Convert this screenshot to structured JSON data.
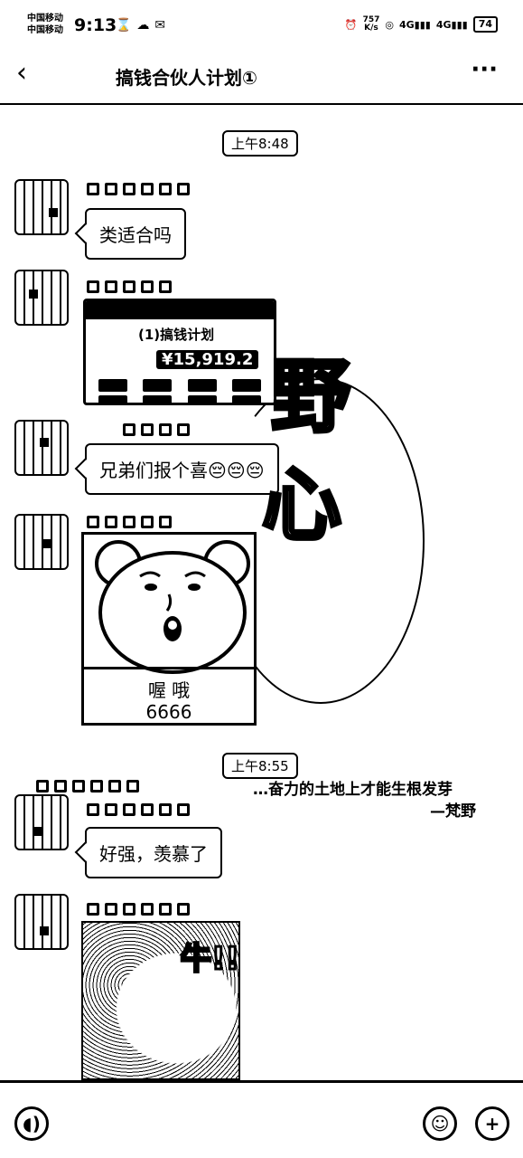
{
  "status_bar": {
    "carrier_1": "中国移动",
    "carrier_2": "中国移动",
    "time": "9:13",
    "net_speed_value": "757",
    "net_speed_unit": "K/s",
    "signal_1": "4G",
    "signal_2": "4G",
    "battery": "74"
  },
  "header": {
    "back_icon": "‹",
    "title": "搞钱合伙人计划①",
    "more_icon": "···"
  },
  "chat": {
    "timestamp_1": "上午8:48",
    "message_1": "类适合吗",
    "card": {
      "title": "(1)搞钱计划",
      "amount": "¥15,919.2"
    },
    "message_2": "兄弟们报个喜😔😔😔",
    "deco_char_1": "野",
    "deco_char_2": "心",
    "sticker": {
      "caption_1": "喔 哦",
      "caption_2": "6666"
    },
    "timestamp_2": "上午8:55",
    "banner_line_1": "…奋力的土地上才能生根发芽",
    "banner_line_2": "—梵野",
    "message_3": "好强，羡慕了",
    "image_text": "牛!!"
  },
  "input_bar": {
    "voice_icon": "voice-icon",
    "emoji_icon": "emoji-icon",
    "add_icon": "plus-icon"
  }
}
